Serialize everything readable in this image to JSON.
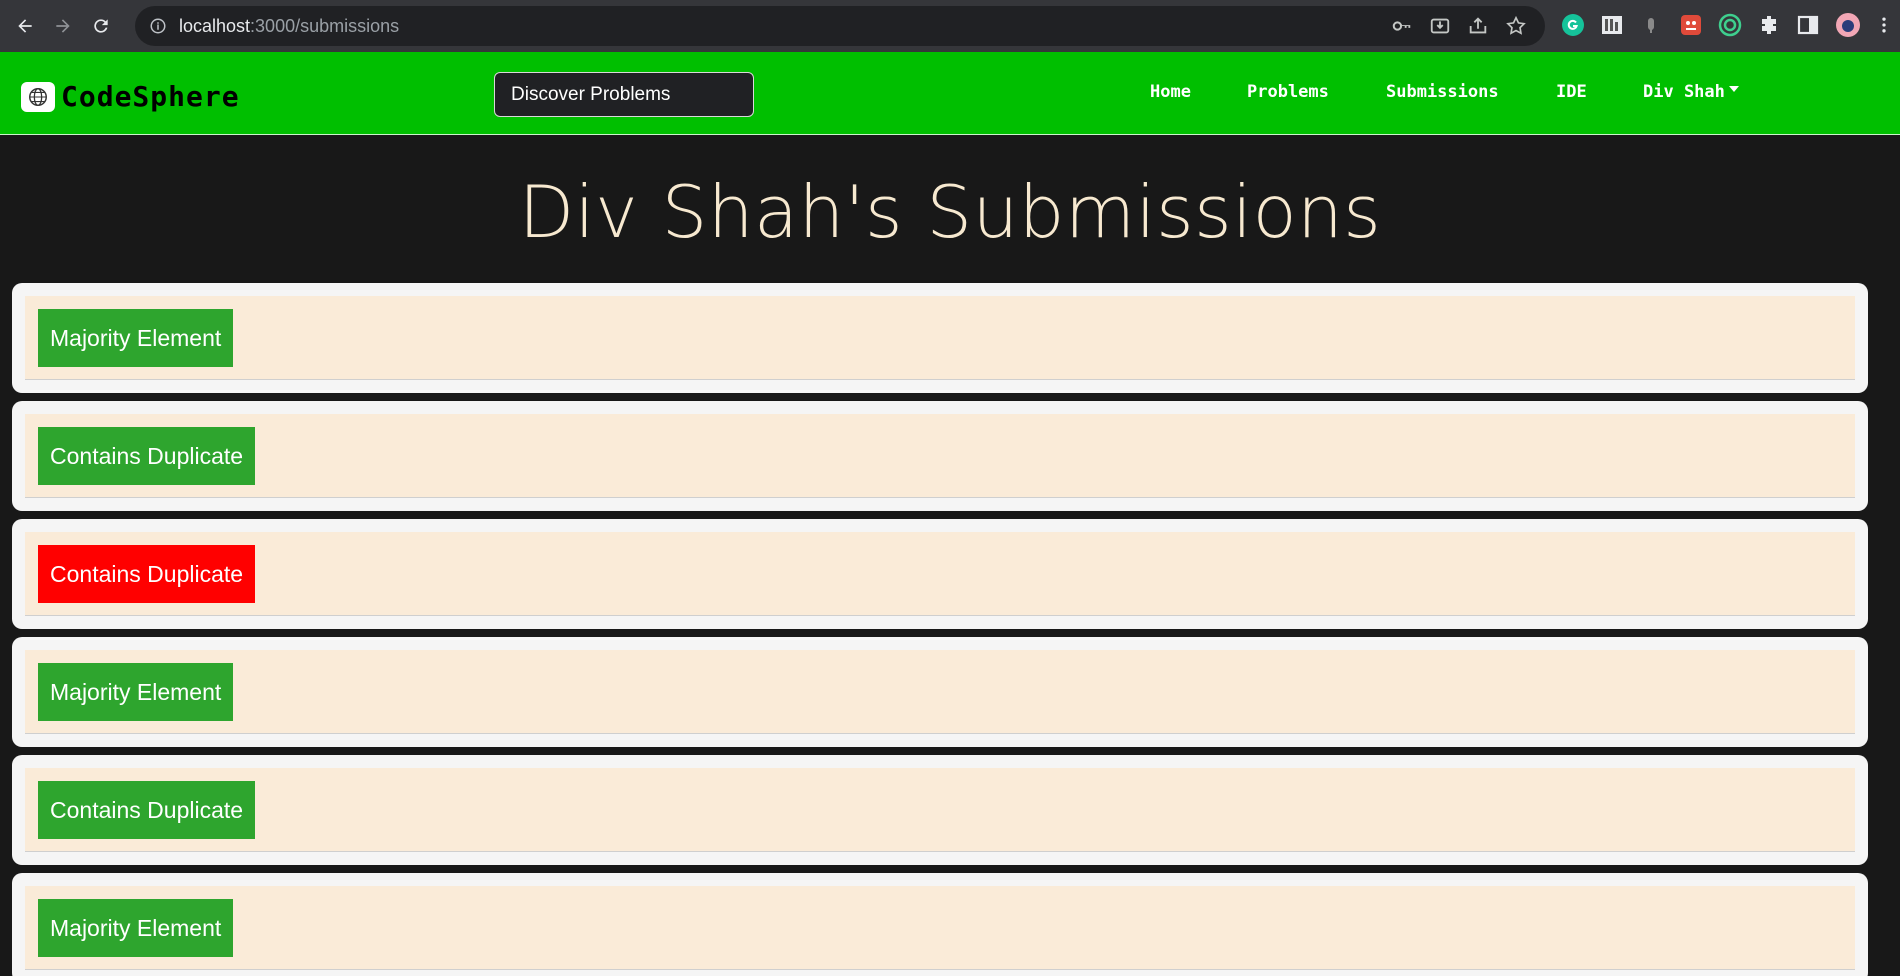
{
  "browser": {
    "url_host": "localhost",
    "url_path": ":3000/submissions"
  },
  "navbar": {
    "brand": "CodeSphere",
    "discover_label": "Discover Problems",
    "links": [
      "Home",
      "Problems",
      "Submissions",
      "IDE"
    ],
    "user_menu": "Div Shah",
    "accent_color": "#00bf00"
  },
  "page": {
    "title": "Div Shah's Submissions"
  },
  "submissions": [
    {
      "problem": "Majority Element",
      "status_color": "#2ea52e"
    },
    {
      "problem": "Contains Duplicate",
      "status_color": "#2ea52e"
    },
    {
      "problem": "Contains Duplicate",
      "status_color": "#ff0000"
    },
    {
      "problem": "Majority Element",
      "status_color": "#2ea52e"
    },
    {
      "problem": "Contains Duplicate",
      "status_color": "#2ea52e"
    },
    {
      "problem": "Majority Element",
      "status_color": "#2ea52e"
    }
  ]
}
